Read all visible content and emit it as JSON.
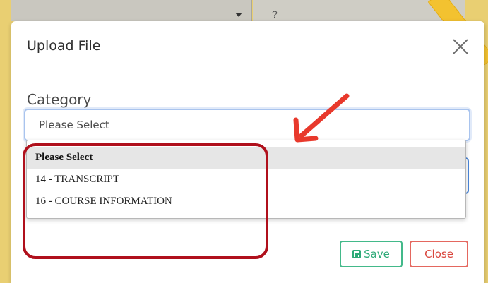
{
  "background": {
    "partial_field_text": "?"
  },
  "modal": {
    "title": "Upload File",
    "category_label": "Category",
    "category_select_value": "Please Select",
    "dropdown_options": [
      "Please Select",
      "14 - TRANSCRIPT",
      "16 - COURSE INFORMATION"
    ],
    "selected_option_index": 0,
    "save_label": "Save",
    "close_label": "Close"
  },
  "colors": {
    "page_background": "#f2d77a",
    "save_accent": "#2eaa78",
    "close_accent": "#d9463d",
    "annotation_red": "#b0101c",
    "select_focus": "#a9c4ee"
  },
  "icons": {
    "close": "close-icon",
    "save": "save-icon",
    "dropdown_caret": "chevron-down-icon"
  }
}
